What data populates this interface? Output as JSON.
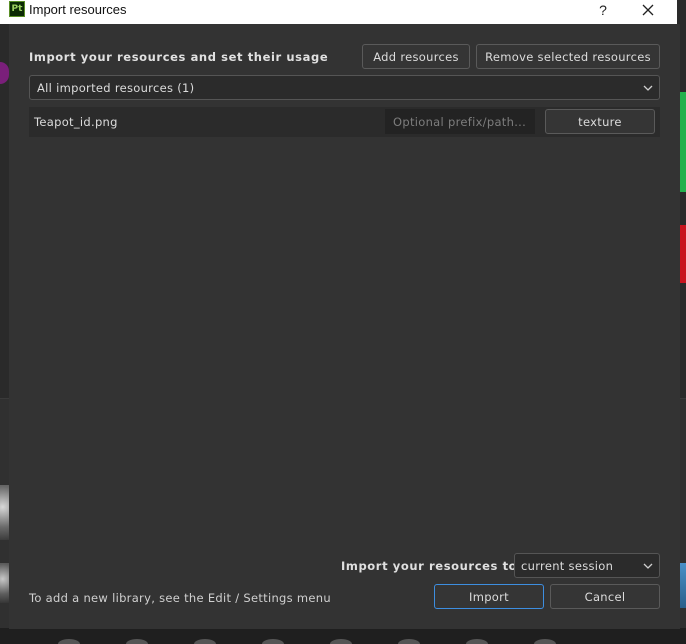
{
  "window": {
    "app_icon_text": "Pt",
    "title": "Import resources",
    "help_label": "?",
    "close_icon": "close-icon"
  },
  "header": {
    "heading": "Import your resources and set their usage",
    "add_label": "Add resources",
    "remove_label": "Remove selected resources"
  },
  "filter": {
    "selected": "All imported resources (1)"
  },
  "resources": [
    {
      "name": "Teapot_id.png",
      "prefix_placeholder": "Optional prefix/path...",
      "usage": "texture"
    }
  ],
  "destination": {
    "label": "Import your resources to:",
    "selected": "current session"
  },
  "footer": {
    "hint": "To add a new library, see the Edit / Settings menu",
    "import_label": "Import",
    "cancel_label": "Cancel"
  },
  "colors": {
    "dialog_bg": "#333333",
    "list_bg": "#2b2b2b",
    "primary_border": "#3d8ee0"
  }
}
